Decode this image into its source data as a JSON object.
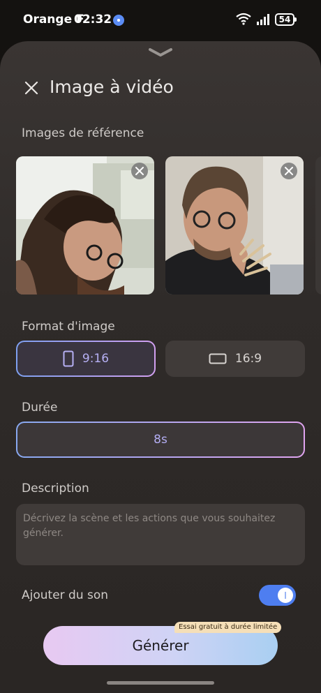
{
  "status_bar": {
    "carrier": "Orange F",
    "time": "02:32",
    "battery": "54"
  },
  "header": {
    "title": "Image à vidéo"
  },
  "reference_images": {
    "label": "Images de référence"
  },
  "format": {
    "label": "Format d'image",
    "options": [
      {
        "label": "9:16",
        "selected": true
      },
      {
        "label": "16:9",
        "selected": false
      }
    ]
  },
  "duration": {
    "label": "Durée",
    "value": "8s"
  },
  "description": {
    "label": "Description",
    "placeholder": "Décrivez la scène et les actions que vous souhaitez générer.",
    "value": ""
  },
  "sound": {
    "label": "Ajouter du son",
    "enabled": true
  },
  "generate": {
    "label": "Générer",
    "badge": "Essai gratuit à durée limitée"
  },
  "colors": {
    "accent": "#4e7ef0",
    "selected_text": "#b6b0f4",
    "sheet_bg": "#2f2b29"
  }
}
